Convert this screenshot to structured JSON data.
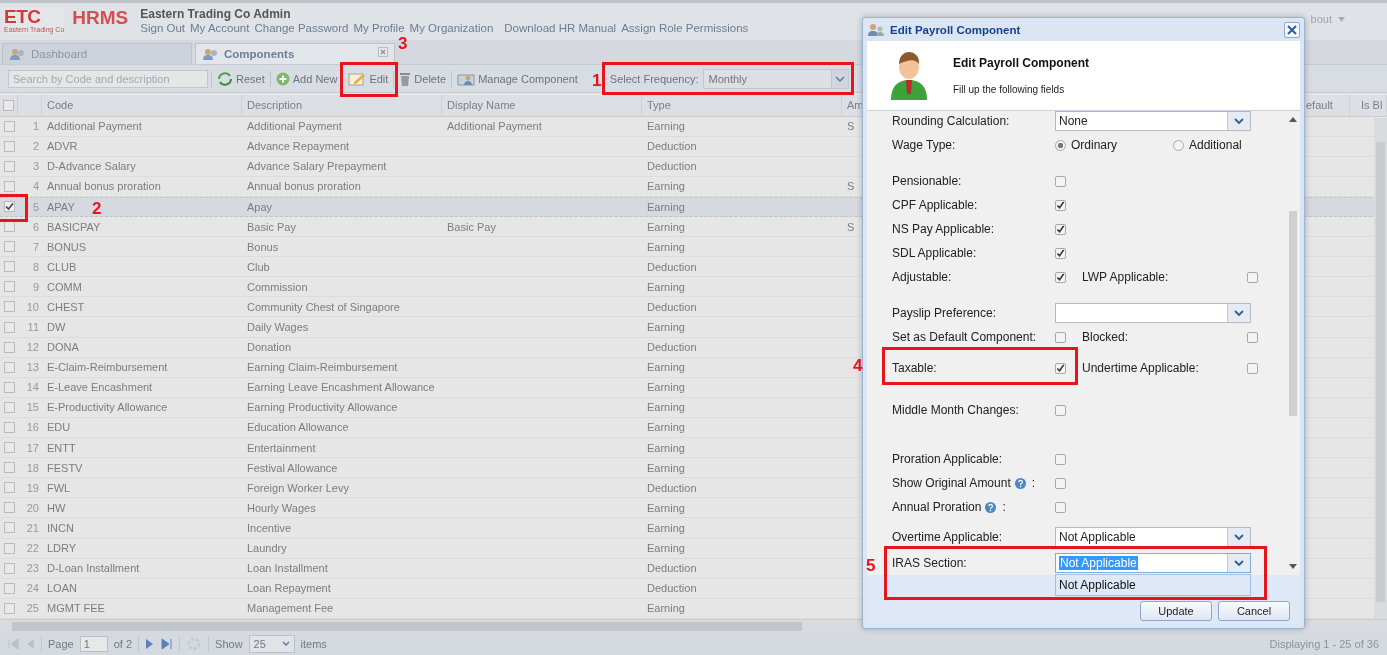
{
  "header": {
    "logo": "ETC",
    "logo_tagline": "Eastern Trading Co",
    "product": "HRMS",
    "company": "Eastern Trading Co Admin",
    "links": [
      "Sign Out",
      "My Account",
      "Change Password",
      "My Profile",
      "My Organization",
      "Download HR Manual",
      "Assign Role Permissions"
    ],
    "right_menu": "bout"
  },
  "tabs": [
    {
      "label": "Dashboard",
      "selected": false,
      "closable": false
    },
    {
      "label": "Components",
      "selected": true,
      "closable": true
    }
  ],
  "toolbar": {
    "search_placeholder": "Search by Code and description",
    "buttons": [
      "Reset",
      "Add New",
      "Edit",
      "Delete",
      "Manage Component"
    ],
    "frequency_label": "Select Frequency:",
    "frequency_value": "Monthly"
  },
  "table": {
    "all_selected": false,
    "columns": [
      "Code",
      "Description",
      "Display Name",
      "Type",
      "Am"
    ],
    "right_columns": [
      "efault",
      "Is Bl"
    ],
    "rows": [
      {
        "num": "1",
        "code": "Additional Payment",
        "description": "Additional Payment",
        "display_name": "Additional Payment",
        "type": "Earning",
        "column_5": "S",
        "selected": false
      },
      {
        "num": "2",
        "code": "ADVR",
        "description": "Advance Repayment",
        "display_name": "",
        "type": "Deduction",
        "column_5": "",
        "selected": false
      },
      {
        "num": "3",
        "code": "D-Advance Salary",
        "description": "Advance Salary Prepayment",
        "display_name": "",
        "type": "Deduction",
        "column_5": "",
        "selected": false
      },
      {
        "num": "4",
        "code": "Annual bonus proration",
        "description": "Annual bonus proration",
        "display_name": "",
        "type": "Earning",
        "column_5": "S",
        "selected": false
      },
      {
        "num": "5",
        "code": "APAY",
        "description": "Apay",
        "display_name": "",
        "type": "Earning",
        "column_5": "",
        "selected": true
      },
      {
        "num": "6",
        "code": "BASICPAY",
        "description": "Basic Pay",
        "display_name": "Basic Pay",
        "type": "Earning",
        "column_5": "S",
        "selected": false
      },
      {
        "num": "7",
        "code": "BONUS",
        "description": "Bonus",
        "display_name": "",
        "type": "Earning",
        "column_5": "",
        "selected": false
      },
      {
        "num": "8",
        "code": "CLUB",
        "description": "Club",
        "display_name": "",
        "type": "Deduction",
        "column_5": "",
        "selected": false
      },
      {
        "num": "9",
        "code": "COMM",
        "description": "Commission",
        "display_name": "",
        "type": "Earning",
        "column_5": "",
        "selected": false
      },
      {
        "num": "10",
        "code": "CHEST",
        "description": "Community Chest of Singapore",
        "display_name": "",
        "type": "Deduction",
        "column_5": "",
        "selected": false
      },
      {
        "num": "11",
        "code": "DW",
        "description": "Daily Wages",
        "display_name": "",
        "type": "Earning",
        "column_5": "",
        "selected": false
      },
      {
        "num": "12",
        "code": "DONA",
        "description": "Donation",
        "display_name": "",
        "type": "Deduction",
        "column_5": "",
        "selected": false
      },
      {
        "num": "13",
        "code": "E-Claim-Reimbursement",
        "description": "Earning Claim-Reimbursement",
        "display_name": "",
        "type": "Earning",
        "column_5": "",
        "selected": false
      },
      {
        "num": "14",
        "code": "E-Leave Encashment",
        "description": "Earning Leave Encashment Allowance",
        "display_name": "",
        "type": "Earning",
        "column_5": "",
        "selected": false
      },
      {
        "num": "15",
        "code": "E-Productivity Allowance",
        "description": "Earning Productivity Allowance",
        "display_name": "",
        "type": "Earning",
        "column_5": "",
        "selected": false
      },
      {
        "num": "16",
        "code": "EDU",
        "description": "Education Allowance",
        "display_name": "",
        "type": "Earning",
        "column_5": "",
        "selected": false
      },
      {
        "num": "17",
        "code": "ENTT",
        "description": "Entertainment",
        "display_name": "",
        "type": "Earning",
        "column_5": "",
        "selected": false
      },
      {
        "num": "18",
        "code": "FESTV",
        "description": "Festival Allowance",
        "display_name": "",
        "type": "Earning",
        "column_5": "",
        "selected": false
      },
      {
        "num": "19",
        "code": "FWL",
        "description": "Foreign Worker Levy",
        "display_name": "",
        "type": "Deduction",
        "column_5": "",
        "selected": false
      },
      {
        "num": "20",
        "code": "HW",
        "description": "Hourly Wages",
        "display_name": "",
        "type": "Earning",
        "column_5": "",
        "selected": false
      },
      {
        "num": "21",
        "code": "INCN",
        "description": "Incentive",
        "display_name": "",
        "type": "Earning",
        "column_5": "",
        "selected": false
      },
      {
        "num": "22",
        "code": "LDRY",
        "description": "Laundry",
        "display_name": "",
        "type": "Earning",
        "column_5": "",
        "selected": false
      },
      {
        "num": "23",
        "code": "D-Loan Installment",
        "description": "Loan Installment",
        "display_name": "",
        "type": "Deduction",
        "column_5": "",
        "selected": false
      },
      {
        "num": "24",
        "code": "LOAN",
        "description": "Loan Repayment",
        "display_name": "",
        "type": "Deduction",
        "column_5": "",
        "selected": false
      },
      {
        "num": "25",
        "code": "MGMT FEE",
        "description": "Management Fee",
        "display_name": "",
        "type": "Earning",
        "column_5": "",
        "selected": false
      }
    ]
  },
  "pager": {
    "page_label": "Page",
    "page": "1",
    "of": "of 2",
    "show_label": "Show",
    "page_size": "25",
    "items_label": "items",
    "summary": "Displaying 1 - 25 of 36"
  },
  "dialog": {
    "title": "Edit Payroll Component",
    "heading": "Edit Payroll Component",
    "subtitle": "Fill up the following fields",
    "groups": [
      [
        {
          "kind": "select",
          "label": "Rounding Calculation:",
          "value": "None",
          "focused": false
        },
        {
          "kind": "radio",
          "label": "Wage Type:",
          "options": [
            {
              "label": "Ordinary",
              "selected": true
            },
            {
              "label": "Additional",
              "selected": false
            }
          ]
        }
      ],
      [
        {
          "kind": "check",
          "label": "Pensionable:",
          "checked": false
        },
        {
          "kind": "check",
          "label": "CPF Applicable:",
          "checked": true
        },
        {
          "kind": "check",
          "label": "NS Pay Applicable:",
          "checked": true
        },
        {
          "kind": "check",
          "label": "SDL Applicable:",
          "checked": true
        },
        {
          "kind": "check",
          "label": "Adjustable:",
          "checked": true,
          "second": {
            "label": "LWP Applicable:",
            "checked": false
          }
        }
      ],
      [
        {
          "kind": "select",
          "label": "Payslip Preference:",
          "focused": false
        },
        {
          "kind": "check",
          "label": "Set as Default Component:",
          "checked": false,
          "second": {
            "label": "Blocked:",
            "checked": false
          }
        },
        {
          "kind": "check",
          "label": "Taxable:",
          "checked": true,
          "second": {
            "label": "Undertime Applicable:",
            "checked": false
          }
        }
      ],
      [
        {
          "kind": "check",
          "label": "Middle Month Changes:",
          "checked": false
        }
      ],
      [
        {
          "kind": "check",
          "label": "Proration Applicable:",
          "checked": false
        },
        {
          "kind": "check",
          "label": "Show Original Amount",
          "help": true,
          "label_end": ":",
          "checked": false
        },
        {
          "kind": "check",
          "label": "Annual Proration",
          "help": true,
          "label_end": ":",
          "checked": false
        },
        {
          "kind": "select",
          "label": "Overtime Applicable:",
          "value": "Not Applicable",
          "focused": false
        },
        {
          "kind": "select",
          "label": "IRAS Section:",
          "value": "Not Applicable",
          "focused": true,
          "options": [
            "Not Applicable"
          ]
        }
      ]
    ],
    "buttons": [
      "Update",
      "Cancel"
    ]
  },
  "annotations": [
    {
      "label": "1"
    },
    {
      "label": "2"
    },
    {
      "label": "3"
    },
    {
      "label": "4"
    },
    {
      "label": "5"
    }
  ]
}
